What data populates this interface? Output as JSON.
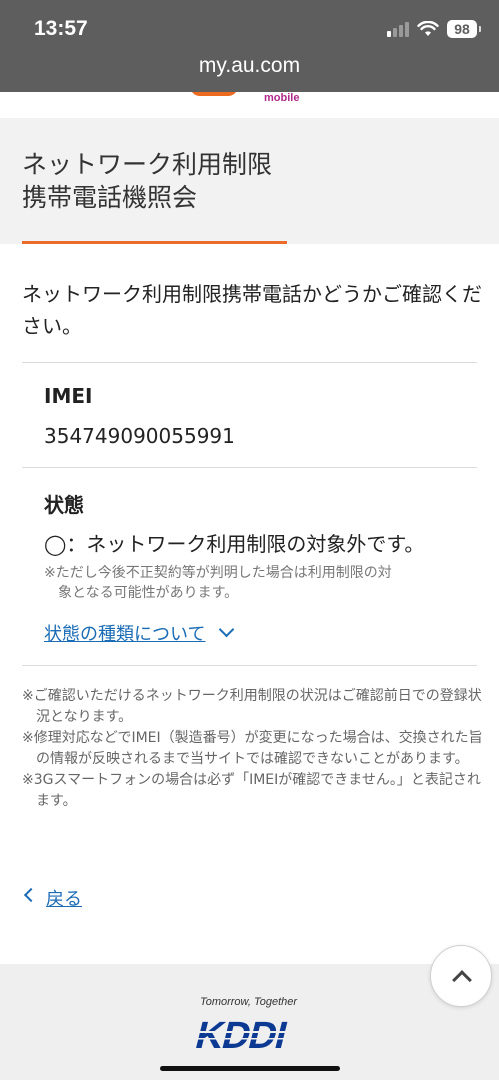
{
  "status_bar": {
    "time": "13:57",
    "battery": "98",
    "url": "my.au.com"
  },
  "brand": {
    "mobile_label": "mobile"
  },
  "header": {
    "title_line1": "ネットワーク利用制限",
    "title_line2": "携帯電話機照会"
  },
  "intro": "ネットワーク利用制限携帯電話かどうかご確認ください。",
  "imei": {
    "label": "IMEI",
    "value": "354749090055991"
  },
  "status": {
    "label": "状態",
    "value": "◯：ネットワーク利用制限の対象外です。",
    "note_line1": "※ただし今後不正契約等が判明した場合は利用制限の対",
    "note_line2": "象となる可能性があります。",
    "types_link": "状態の種類について"
  },
  "notes": [
    "※ご確認いただけるネットワーク利用制限の状況はご確認前日での登録状況となります。",
    "※修理対応などでIMEI（製造番号）が変更になった場合は、交換された旨の情報が反映されるまで当サイトでは確認できないことがあります。",
    "※3Gスマートフォンの場合は必ず「IMEIが確認できません。」と表記されます。"
  ],
  "back_link": "戻る",
  "footer": {
    "tagline": "Tomorrow, Together",
    "logo_text": "KDDI"
  },
  "colors": {
    "accent_orange": "#eb6b2a",
    "link_blue": "#1a6cb5",
    "kddi_blue": "#0c3a93"
  }
}
